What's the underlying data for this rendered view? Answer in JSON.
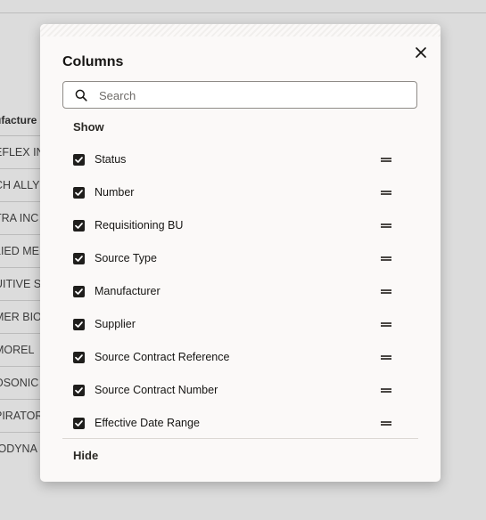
{
  "background": {
    "column_header": "ufacture",
    "rows": [
      "EFLEX IN",
      "CH ALLY",
      "TRA INC",
      "LIED ME",
      "UITIVE SU",
      "MER BIO",
      "MOREL",
      "OSONIC",
      "PIRATOR",
      "IODYNA"
    ]
  },
  "dialog": {
    "title": "Columns",
    "close_icon": "close-icon",
    "search": {
      "placeholder": "Search",
      "value": ""
    },
    "show_label": "Show",
    "hide_label": "Hide",
    "columns": [
      {
        "label": "Status",
        "checked": true
      },
      {
        "label": "Number",
        "checked": true
      },
      {
        "label": "Requisitioning BU",
        "checked": true
      },
      {
        "label": "Source Type",
        "checked": true
      },
      {
        "label": "Manufacturer",
        "checked": true
      },
      {
        "label": "Supplier",
        "checked": true
      },
      {
        "label": "Source Contract Reference",
        "checked": true
      },
      {
        "label": "Source Contract Number",
        "checked": true
      },
      {
        "label": "Effective Date Range",
        "checked": true
      }
    ]
  },
  "colors": {
    "overlay": "#dcdcdc",
    "dialog_bg": "#fbf9f8",
    "checkbox": "#1f1e1c"
  }
}
